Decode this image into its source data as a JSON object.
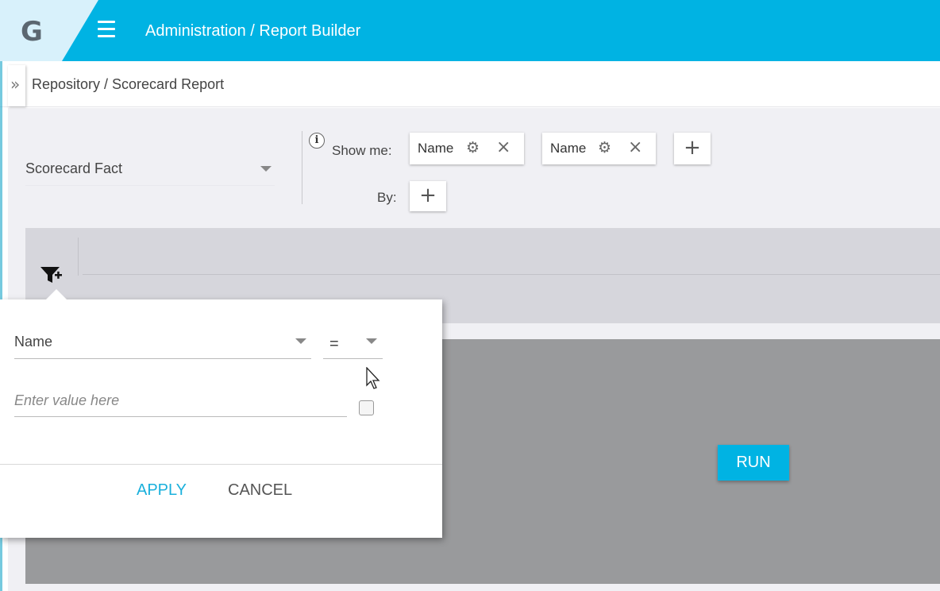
{
  "header": {
    "logo_letter": "G",
    "title": "Administration / Report Builder",
    "colors": {
      "accent": "#00b3e3",
      "logo_bg": "#d8f1fb"
    }
  },
  "breadcrumb": {
    "expander": "»",
    "path": "Repository / Scorecard Report"
  },
  "builder": {
    "fact_select": {
      "value": "Scorecard Fact"
    },
    "show_me_label": "Show me:",
    "by_label": "By:",
    "show_me_chips": [
      {
        "label": "Name"
      },
      {
        "label": "Name"
      }
    ],
    "add_icon": "+",
    "info_icon": "i"
  },
  "filter_popup": {
    "field_value": "Name",
    "operator_value": "=",
    "value_placeholder": "Enter value here",
    "apply_label": "APPLY",
    "cancel_label": "CANCEL"
  },
  "results": {
    "run_label": "RUN"
  }
}
